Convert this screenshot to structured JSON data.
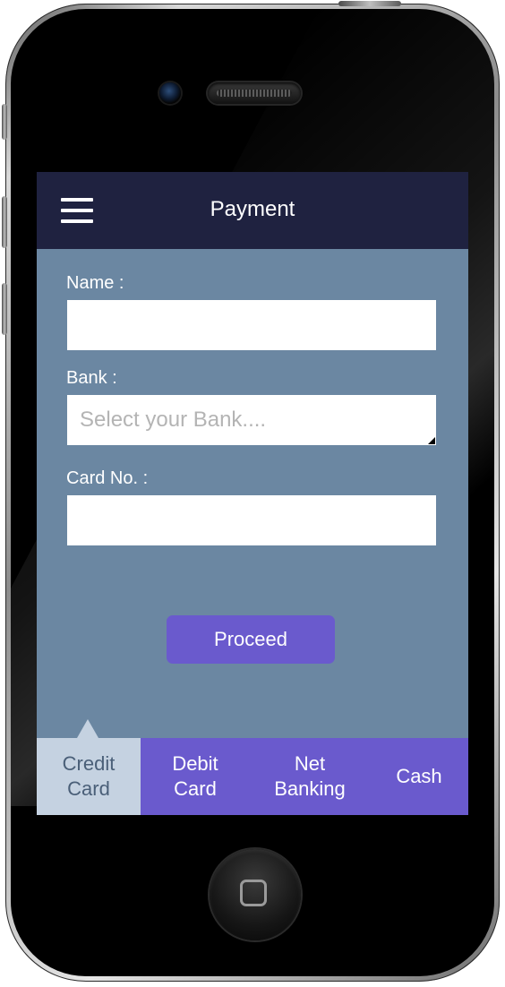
{
  "header": {
    "title": "Payment",
    "menu_icon": "hamburger-menu-icon"
  },
  "form": {
    "name_label": "Name :",
    "name_value": "",
    "bank_label": "Bank :",
    "bank_placeholder": "Select your Bank....",
    "card_label": "Card No. :",
    "card_value": ""
  },
  "proceed_label": "Proceed",
  "tabs": [
    {
      "line1": "Credit",
      "line2": "Card",
      "active": true
    },
    {
      "line1": "Debit",
      "line2": "Card",
      "active": false
    },
    {
      "line1": "Net",
      "line2": "Banking",
      "active": false
    },
    {
      "line1": "Cash",
      "line2": "",
      "active": false
    }
  ],
  "colors": {
    "header_bg": "#1f2240",
    "screen_bg": "#6b87a2",
    "accent": "#6a5acd",
    "active_tab_bg": "#c5d2e1",
    "active_tab_text": "#4a5f78"
  }
}
